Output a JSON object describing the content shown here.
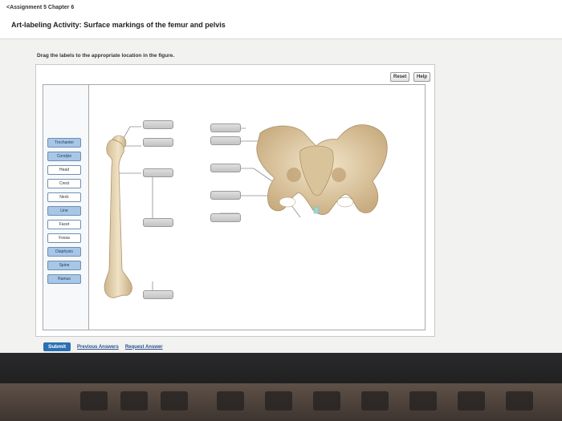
{
  "header": {
    "breadcrumb": "<Assignment 5 Chapter 6",
    "title": "Art-labeling Activity: Surface markings of the femur and pelvis"
  },
  "instruction": "Drag the labels to the appropriate location in the figure.",
  "controls": {
    "reset_label": "Reset",
    "help_label": "Help"
  },
  "labels": [
    {
      "text": "Trochanter",
      "style": "blue"
    },
    {
      "text": "Condyle",
      "style": "blue"
    },
    {
      "text": "Head",
      "style": "white"
    },
    {
      "text": "Crest",
      "style": "white"
    },
    {
      "text": "Neck",
      "style": "white"
    },
    {
      "text": "Line",
      "style": "blue"
    },
    {
      "text": "Facet",
      "style": "white"
    },
    {
      "text": "Fossa",
      "style": "white"
    },
    {
      "text": "Diaphysis",
      "style": "blue"
    },
    {
      "text": "Spine",
      "style": "blue"
    },
    {
      "text": "Ramus",
      "style": "blue"
    }
  ],
  "footer": {
    "submit_label": "Submit",
    "previous_answers_label": "Previous Answers",
    "request_answer_label": "Request Answer"
  },
  "colors": {
    "accent": "#2b6fb4",
    "label_blue": "#a8c6e6",
    "bone": "#e8d9b8"
  }
}
